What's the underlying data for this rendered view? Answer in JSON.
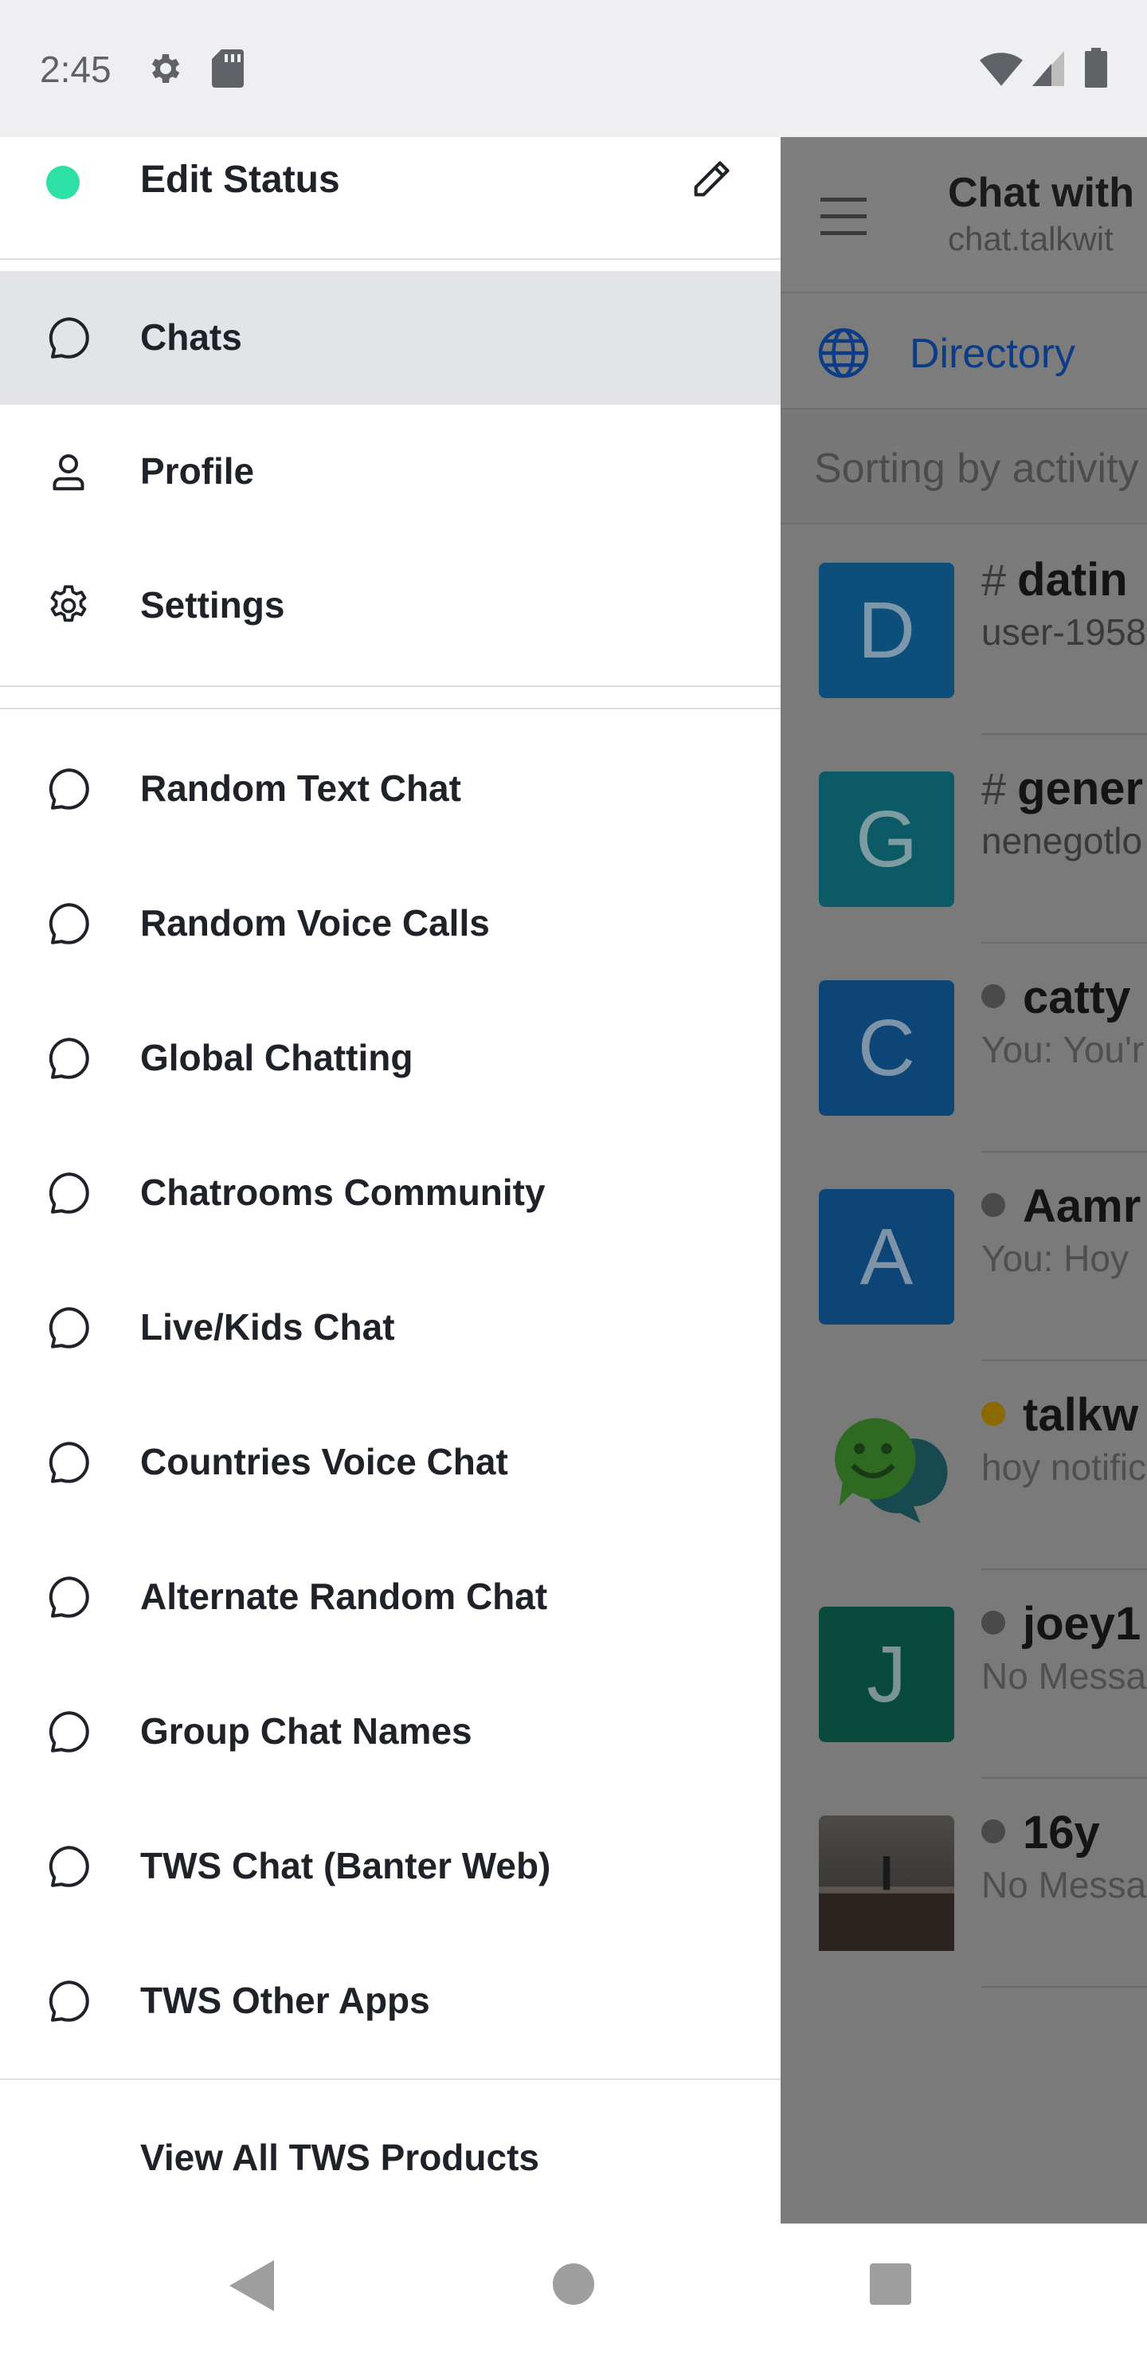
{
  "status_bar": {
    "time": "2:45",
    "icons": [
      "gear-icon",
      "sd-card-icon",
      "wifi-icon",
      "signal-icon",
      "battery-icon"
    ]
  },
  "background_screen": {
    "title": "Chat with",
    "subtitle": "chat.talkwit",
    "directory_label": "Directory",
    "sort_label": "Sorting by activity",
    "rows": [
      {
        "avatar_letter": "D",
        "avatar_color": "#0b4f7a",
        "prefix": "#",
        "name": "datin",
        "preview": "user-1958"
      },
      {
        "avatar_letter": "G",
        "avatar_color": "#0c5a66",
        "prefix": "#",
        "name": "gener",
        "preview": "nenegotlo"
      },
      {
        "avatar_letter": "C",
        "avatar_color": "#0e4577",
        "prefix": "",
        "status_dot": "#4a4a4a",
        "name": "catty",
        "preview": "You: You'r"
      },
      {
        "avatar_letter": "A",
        "avatar_color": "#0e4577",
        "prefix": "",
        "status_dot": "#4a4a4a",
        "name": "Aamr",
        "preview": "You: Hoy"
      },
      {
        "avatar_letter": "",
        "avatar_color": "#7a7a7a",
        "prefix": "",
        "status_dot": "#8a6a00",
        "name": "talkw",
        "preview": "hoy notific"
      },
      {
        "avatar_letter": "J",
        "avatar_color": "#0a4a3c",
        "prefix": "",
        "status_dot": "#4a4a4a",
        "name": "joey1",
        "preview": "No Messa"
      },
      {
        "avatar_letter": "",
        "avatar_color": "#3a3530",
        "prefix": "",
        "status_dot": "#4a4a4a",
        "name": "16y",
        "preview": "No Messa"
      }
    ]
  },
  "drawer": {
    "status_label": "Edit Status",
    "status_color": "#2de0a5",
    "main_items": [
      {
        "label": "Chats",
        "icon": "chat-bubble-icon",
        "active": true
      },
      {
        "label": "Profile",
        "icon": "person-icon",
        "active": false
      },
      {
        "label": "Settings",
        "icon": "gear-icon",
        "active": false
      }
    ],
    "link_items": [
      {
        "label": "Random Text Chat"
      },
      {
        "label": "Random Voice Calls"
      },
      {
        "label": "Global Chatting"
      },
      {
        "label": "Chatrooms Community"
      },
      {
        "label": "Live/Kids Chat"
      },
      {
        "label": "Countries Voice Chat"
      },
      {
        "label": "Alternate Random Chat"
      },
      {
        "label": "Group Chat Names"
      },
      {
        "label": "TWS Chat (Banter Web)"
      },
      {
        "label": "TWS Other Apps"
      }
    ],
    "footer_label": "View All TWS Products"
  }
}
